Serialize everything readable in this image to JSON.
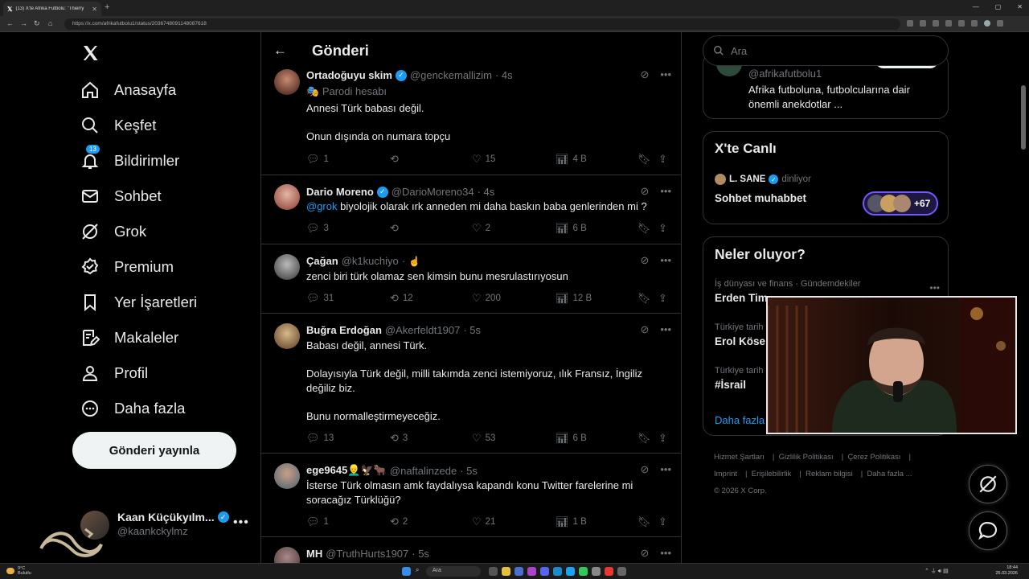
{
  "browser": {
    "tab_title": "(13) X'te Afrika Futbolu: \"Thierry",
    "url": "https://x.com/afrikafutbolu1/status/2036748091148087618"
  },
  "sidebar": {
    "logo": "X",
    "items": [
      {
        "label": "Anasayfa",
        "icon": "home-icon"
      },
      {
        "label": "Keşfet",
        "icon": "search-icon"
      },
      {
        "label": "Bildirimler",
        "icon": "bell-icon",
        "badge": "13"
      },
      {
        "label": "Sohbet",
        "icon": "mail-icon"
      },
      {
        "label": "Grok",
        "icon": "grok-icon"
      },
      {
        "label": "Premium",
        "icon": "premium-icon"
      },
      {
        "label": "Yer İşaretleri",
        "icon": "bookmark-icon"
      },
      {
        "label": "Makaleler",
        "icon": "article-icon"
      },
      {
        "label": "Profil",
        "icon": "person-icon"
      },
      {
        "label": "Daha fazla",
        "icon": "more-circle-icon"
      }
    ],
    "post_button": "Gönderi yayınla",
    "account": {
      "name": "Kaan Küçükyılm...",
      "handle": "@kaankckylmz"
    }
  },
  "header": {
    "title": "Gönderi"
  },
  "tweets": [
    {
      "name": "Ortadoğuyu skim",
      "verified": true,
      "handle": "@genckemallizim",
      "time": "· 4s",
      "parody": "Parodi hesabı",
      "lines": [
        "Annesi Türk babası değil.",
        "Onun dışında on numara topçu"
      ],
      "replies": "1",
      "retweets": "",
      "likes": "15",
      "views": "4 B"
    },
    {
      "name": "Dario Moreno",
      "verified": true,
      "handle": "@DarioMoreno34",
      "time": "· 4s",
      "mention": "@grok",
      "text": " biyolojik olarak ırk anneden mi daha baskın baba genlerinden mi ?",
      "replies": "3",
      "retweets": "",
      "likes": "2",
      "views": "6 B"
    },
    {
      "name": "Çağan",
      "verified": false,
      "handle": "@k1kuchiyo",
      "time": "·",
      "text": "zenci biri türk olamaz sen kimsin bunu mesrulastırıyosun",
      "replies": "31",
      "retweets": "12",
      "likes": "200",
      "views": "12 B"
    },
    {
      "name": "Buğra Erdoğan",
      "verified": false,
      "handle": "@Akerfeldt1907",
      "time": "· 5s",
      "lines": [
        "Babası değil, annesi Türk.",
        "Dolayısıyla Türk değil, milli takımda zenci istemiyoruz, ılık Fransız, İngiliz değiliz biz.",
        "Bunu normalleştirmeyeceğiz."
      ],
      "replies": "13",
      "retweets": "3",
      "likes": "53",
      "views": "6 B"
    },
    {
      "name": "ege9645👱‍♂️🦅🐂",
      "verified": false,
      "handle": "@naftalinzede",
      "time": "· 5s",
      "text": "İsterse Türk olmasın amk faydalıysa kapandı konu Twitter farelerine mi soracağız Türklüğü?",
      "replies": "1",
      "retweets": "2",
      "likes": "21",
      "views": "1 B"
    },
    {
      "name": "MH",
      "verified": false,
      "handle": "@TruthHurts1907",
      "time": "· 5s"
    }
  ],
  "right": {
    "search_placeholder": "Ara",
    "profile_card": {
      "handle": "@afrikafutbolu1",
      "bio": "Afrika futboluna, futbolcularına dair önemli anekdotlar ..."
    },
    "live": {
      "title": "X'te Canlı",
      "host": "L. SANE",
      "host_status": "dinliyor",
      "space_title": "Sohbet muhabbet",
      "count": "+67"
    },
    "trends": {
      "title": "Neler oluyor?",
      "items": [
        {
          "category": "İş dünyası ve finans · Gündemdekiler",
          "name": "Erden Tim"
        },
        {
          "category": "Türkiye tarih",
          "name": "Erol Köse"
        },
        {
          "category": "Türkiye tarih",
          "name": "#İsrail"
        }
      ],
      "more": "Daha fazla"
    },
    "footer": [
      "Hizmet Şartları",
      "Gizlilik Politikası",
      "Çerez Politikası",
      "Imprint",
      "Erişilebilirlik",
      "Reklam bilgisi",
      "Daha fazla ...",
      "© 2026 X Corp."
    ]
  },
  "taskbar": {
    "weather_temp": "9°C",
    "weather_desc": "Bulutlu",
    "search": "Ara",
    "time": "18:44",
    "date": "25.03.2026"
  },
  "colors": {
    "accent": "#1d9bf0",
    "background": "#000000",
    "border": "#2f3336",
    "muted": "#71767b"
  }
}
